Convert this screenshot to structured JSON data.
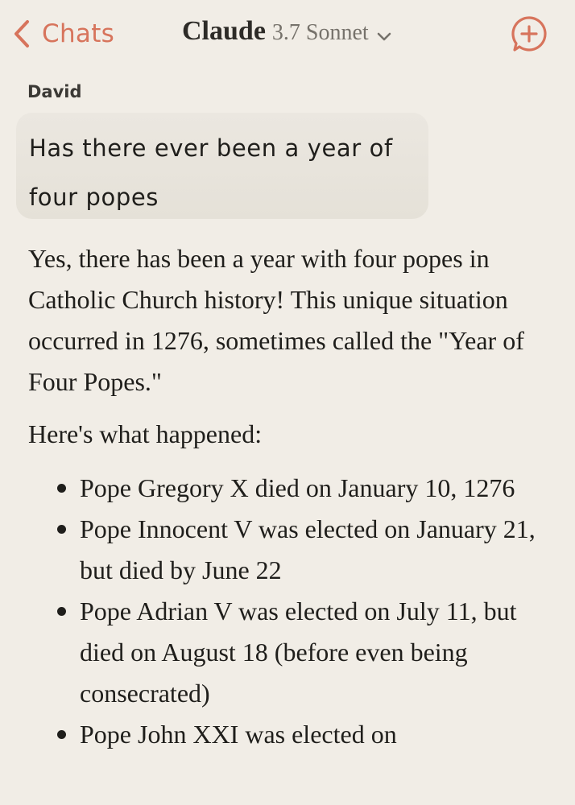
{
  "header": {
    "back_label": "Chats",
    "title_name": "Claude",
    "title_model": "3.7 Sonnet",
    "accent_color": "#d7745c",
    "new_chat_icon": "plus-chat-bubble-icon",
    "back_icon": "chevron-left-icon",
    "model_dropdown_icon": "chevron-down-icon"
  },
  "messages": [
    {
      "author": "David",
      "text": "Has there ever been a year of four popes"
    }
  ],
  "reply": {
    "intro": "Yes, there has been a year with four popes in Catholic Church history! This unique situation occurred in 1276, sometimes called the \"Year of Four Popes.\"",
    "lead": "Here's what happened:",
    "bullets": [
      "Pope Gregory X died on January 10, 1276",
      "Pope Innocent V was elected on January 21, but died by June 22",
      "Pope Adrian V was elected on July 11, but died on August 18 (before even being consecrated)",
      "Pope John XXI was elected on"
    ]
  }
}
